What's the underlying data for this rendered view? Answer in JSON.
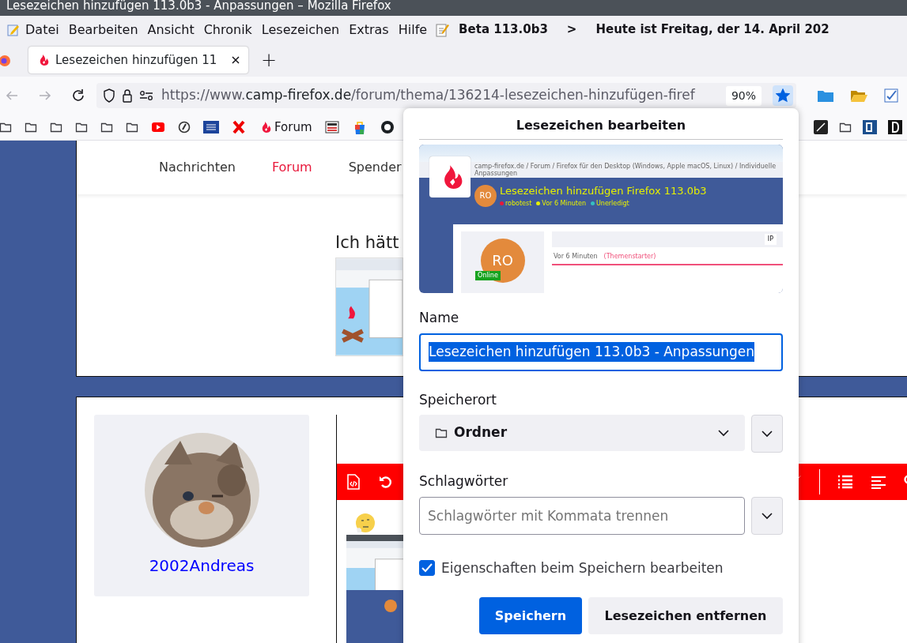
{
  "window": {
    "title": "Lesezeichen hinzufügen 113.0b3 - Anpassungen – Mozilla Firefox"
  },
  "menubar": {
    "items": [
      {
        "label": "Datei"
      },
      {
        "label": "Bearbeiten"
      },
      {
        "label": "Ansicht"
      },
      {
        "label": "Chronik"
      },
      {
        "label": "Lesezeichen"
      },
      {
        "label": "Extras"
      },
      {
        "label": "Hilfe"
      }
    ],
    "version": "Beta 113.0b3",
    "separator": ">",
    "date": "Heute ist Freitag, der 14. April 202"
  },
  "tabs": [
    {
      "label": "Lesezeichen hinzufügen 11",
      "selected": true
    }
  ],
  "new_tab": "+",
  "navbar": {
    "url_prefix": "https://www.",
    "url_host": "camp-firefox.de",
    "url_path": "/forum/thema/136214-lesezeichen-hinzufügen-firef",
    "zoom": "90%",
    "bookmarked": true
  },
  "bookmarks": [
    {
      "kind": "folder"
    },
    {
      "kind": "folder"
    },
    {
      "kind": "folder"
    },
    {
      "kind": "folder"
    },
    {
      "kind": "folder"
    },
    {
      "kind": "folder"
    },
    {
      "kind": "youtube"
    },
    {
      "kind": "at"
    },
    {
      "kind": "gmx"
    },
    {
      "kind": "cross"
    },
    {
      "kind": "link",
      "label": "Forum"
    },
    {
      "kind": "com"
    },
    {
      "kind": "bag"
    },
    {
      "kind": "github"
    }
  ],
  "bookmarks_right": [
    {
      "kind": "pen"
    },
    {
      "kind": "folder"
    },
    {
      "kind": "cb"
    },
    {
      "kind": "d"
    }
  ],
  "page": {
    "nav": [
      {
        "label": "Nachrichten",
        "selected": false
      },
      {
        "label": "Forum",
        "selected": true
      },
      {
        "label": "Spender",
        "selected": false
      }
    ],
    "post_text": "Ich hätt",
    "author": "2002Andreas"
  },
  "popup": {
    "title": "Lesezeichen bearbeiten",
    "preview": {
      "breadcrumb": "camp-firefox.de  /  Forum  /  Firefox für den Desktop (Windows, Apple macOS, Linux)  /  Individuelle Anpassungen",
      "avatar": "RO",
      "title": "Lesezeichen hinzufügen Firefox 113.0b3",
      "meta": [
        "robotest",
        "Vor 6 Minuten",
        "Unerledigt"
      ],
      "ip": "IP",
      "post_avatar": "RO",
      "status": "Online",
      "time": "Vor 6 Minuten",
      "role": "(Themenstarter)"
    },
    "name_label": {
      "label": "Name"
    },
    "name_value": "Lesezeichen hinzufügen 113.0b3 - Anpassungen",
    "location_label": {
      "label": "Speicherort"
    },
    "location_value": "Ordner",
    "tags_label": {
      "label": "Schlagwörter"
    },
    "tags_placeholder": "Schlagwörter mit Kommata trennen",
    "checkbox": {
      "label": "Eigenschaften beim Speichern bearbeiten",
      "checked": true
    },
    "buttons": [
      {
        "label": "Speichern",
        "kind": "primary"
      },
      {
        "label": "Lesezeichen entfernen",
        "kind": "secondary"
      }
    ]
  }
}
